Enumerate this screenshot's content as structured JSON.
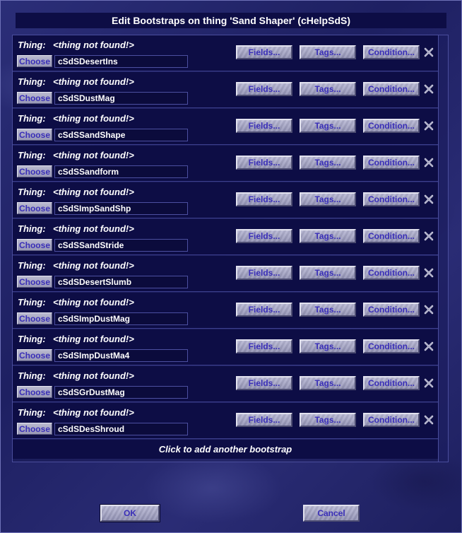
{
  "dialog": {
    "title": "Edit Bootstraps on thing 'Sand Shaper' (cHelpSdS)"
  },
  "row_labels": {
    "thing_label": "Thing:",
    "choose_label": "Choose",
    "fields_label": "Fields...",
    "tags_label": "Tags...",
    "condition_label": "Condition..."
  },
  "bootstraps": [
    {
      "thing": "<thing not found!>",
      "id": "cSdSDesertIns"
    },
    {
      "thing": "<thing not found!>",
      "id": "cSdSDustMag"
    },
    {
      "thing": "<thing not found!>",
      "id": "cSdSSandShape"
    },
    {
      "thing": "<thing not found!>",
      "id": "cSdSSandform"
    },
    {
      "thing": "<thing not found!>",
      "id": "cSdSImpSandShp"
    },
    {
      "thing": "<thing not found!>",
      "id": "cSdSSandStride"
    },
    {
      "thing": "<thing not found!>",
      "id": "cSdSDesertSlumb"
    },
    {
      "thing": "<thing not found!>",
      "id": "cSdSImpDustMag"
    },
    {
      "thing": "<thing not found!>",
      "id": "cSdSImpDustMa4"
    },
    {
      "thing": "<thing not found!>",
      "id": "cSdSGrDustMag"
    },
    {
      "thing": "<thing not found!>",
      "id": "cSdSDesShroud"
    }
  ],
  "add_bootstrap_label": "Click to add another bootstrap",
  "footer": {
    "ok_label": "OK",
    "cancel_label": "Cancel"
  },
  "icons": {
    "delete": "close-x-icon"
  },
  "colors": {
    "row_background": "#0d0d45",
    "button_text": "#3a2fb8",
    "background": "#23256a"
  }
}
